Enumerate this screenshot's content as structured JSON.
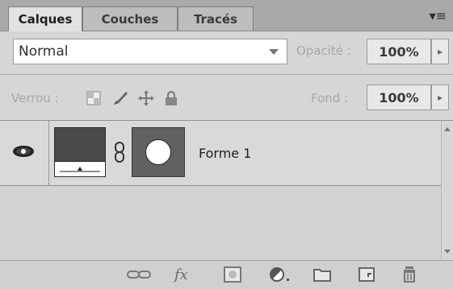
{
  "tabs": [
    {
      "label": "Calques",
      "active": true
    },
    {
      "label": "Couches",
      "active": false
    },
    {
      "label": "Tracés",
      "active": false
    }
  ],
  "blend_mode": "Normal",
  "opacity": {
    "label": "Opacité :",
    "value": "100%"
  },
  "lock": {
    "label": "Verrou :",
    "icons": [
      "transparency-lock-icon",
      "brush-lock-icon",
      "move-lock-icon",
      "padlock-icon"
    ]
  },
  "fill": {
    "label": "Fond :",
    "value": "100%"
  },
  "layers": [
    {
      "name": "Forme 1",
      "visible": true
    }
  ],
  "bottom_icons": [
    "link-icon",
    "fx-icon",
    "mask-icon",
    "adjustment-icon",
    "folder-icon",
    "new-layer-icon",
    "trash-icon"
  ],
  "fx_label": "fx",
  "colors": {
    "panel": "#d6d6d6",
    "tabbar": "#a9a9a9",
    "active_tab": "#e2e2e2"
  }
}
